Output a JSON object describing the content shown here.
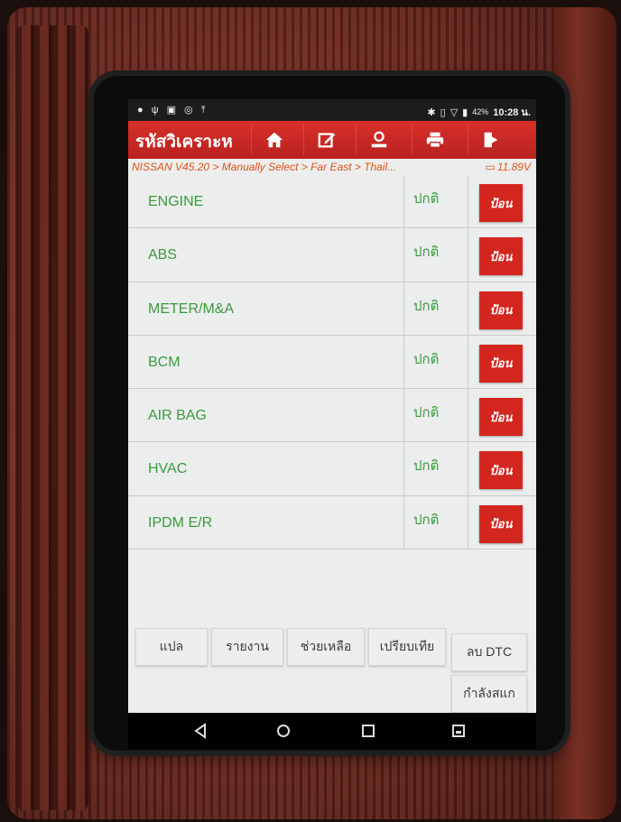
{
  "status_bar": {
    "left_icons": [
      "message-icon",
      "usb-icon",
      "image-icon",
      "clock-icon",
      "upload-icon"
    ],
    "right_icons": [
      "bluetooth-icon",
      "vibrate-icon",
      "wifi-icon",
      "battery-icon"
    ],
    "battery": "42%",
    "time": "10:28 น."
  },
  "header": {
    "title": "รหัสวิเคราะห",
    "buttons": [
      {
        "name": "home",
        "icon": "home-icon"
      },
      {
        "name": "edit",
        "icon": "edit-icon"
      },
      {
        "name": "profile",
        "icon": "user-icon"
      },
      {
        "name": "print",
        "icon": "print-icon"
      },
      {
        "name": "exit",
        "icon": "exit-icon"
      }
    ],
    "accent": "#d3261f"
  },
  "breadcrumb": {
    "path": "NISSAN V45.20 > Manually Select > Far East > Thail...",
    "voltage": "11.89V"
  },
  "systems": [
    {
      "name": "ENGINE",
      "status": "ปกติ",
      "action": "ป้อน"
    },
    {
      "name": "ABS",
      "status": "ปกติ",
      "action": "ป้อน"
    },
    {
      "name": "METER/M&A",
      "status": "ปกติ",
      "action": "ป้อน"
    },
    {
      "name": "BCM",
      "status": "ปกติ",
      "action": "ป้อน"
    },
    {
      "name": "AIR BAG",
      "status": "ปกติ",
      "action": "ป้อน"
    },
    {
      "name": "HVAC",
      "status": "ปกติ",
      "action": "ป้อน"
    },
    {
      "name": "IPDM E/R",
      "status": "ปกติ",
      "action": "ป้อน"
    }
  ],
  "bottom_buttons": {
    "translate": "แปล",
    "report": "รายงาน",
    "help": "ช่วยเหลือ",
    "compare": "เปรียบเทีย",
    "clear_dtc": "ลบ DTC",
    "scanning": "กำลังสแก"
  },
  "nav": [
    "back-icon",
    "home-icon",
    "recents-icon",
    "screenshot-icon"
  ]
}
